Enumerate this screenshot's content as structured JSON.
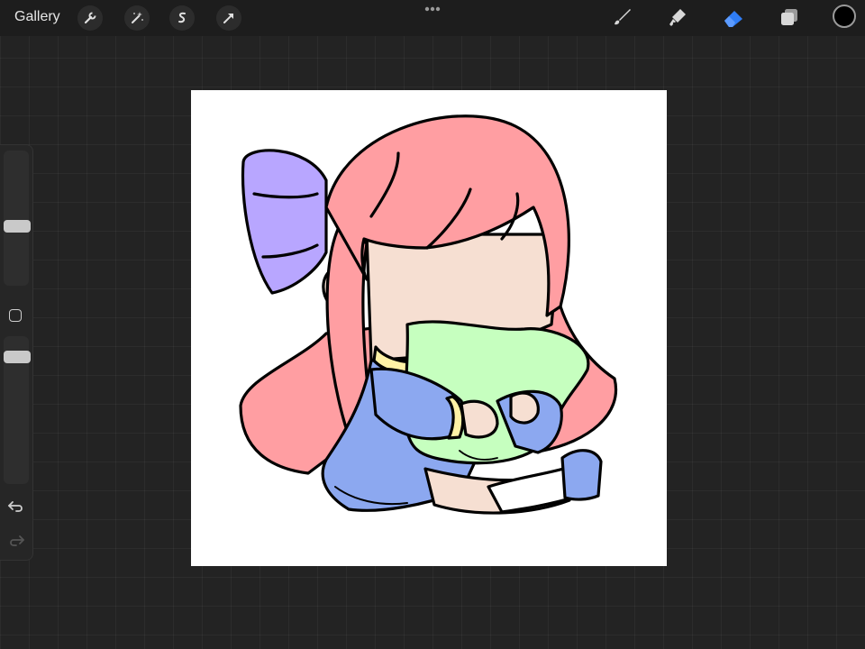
{
  "topbar": {
    "gallery_label": "Gallery",
    "left_tools": [
      "wrench-icon",
      "magic-wand-icon",
      "selection-icon",
      "transform-arrow-icon"
    ],
    "more_icon": "ellipsis-icon",
    "right_tools": [
      "brush-icon",
      "smudge-icon",
      "eraser-icon",
      "layers-icon"
    ],
    "active_tool": "eraser",
    "active_color": "#000000",
    "accent_color": "#2f7df6"
  },
  "sidebar": {
    "size_slider_level": 0.45,
    "opacity_slider_level": 0.95,
    "modify_icon": "square-icon",
    "undo_icon": "undo-icon",
    "redo_icon": "redo-icon"
  },
  "canvas": {
    "background": "#ffffff",
    "illustration": "chibi-girl-hugging-pillow"
  }
}
